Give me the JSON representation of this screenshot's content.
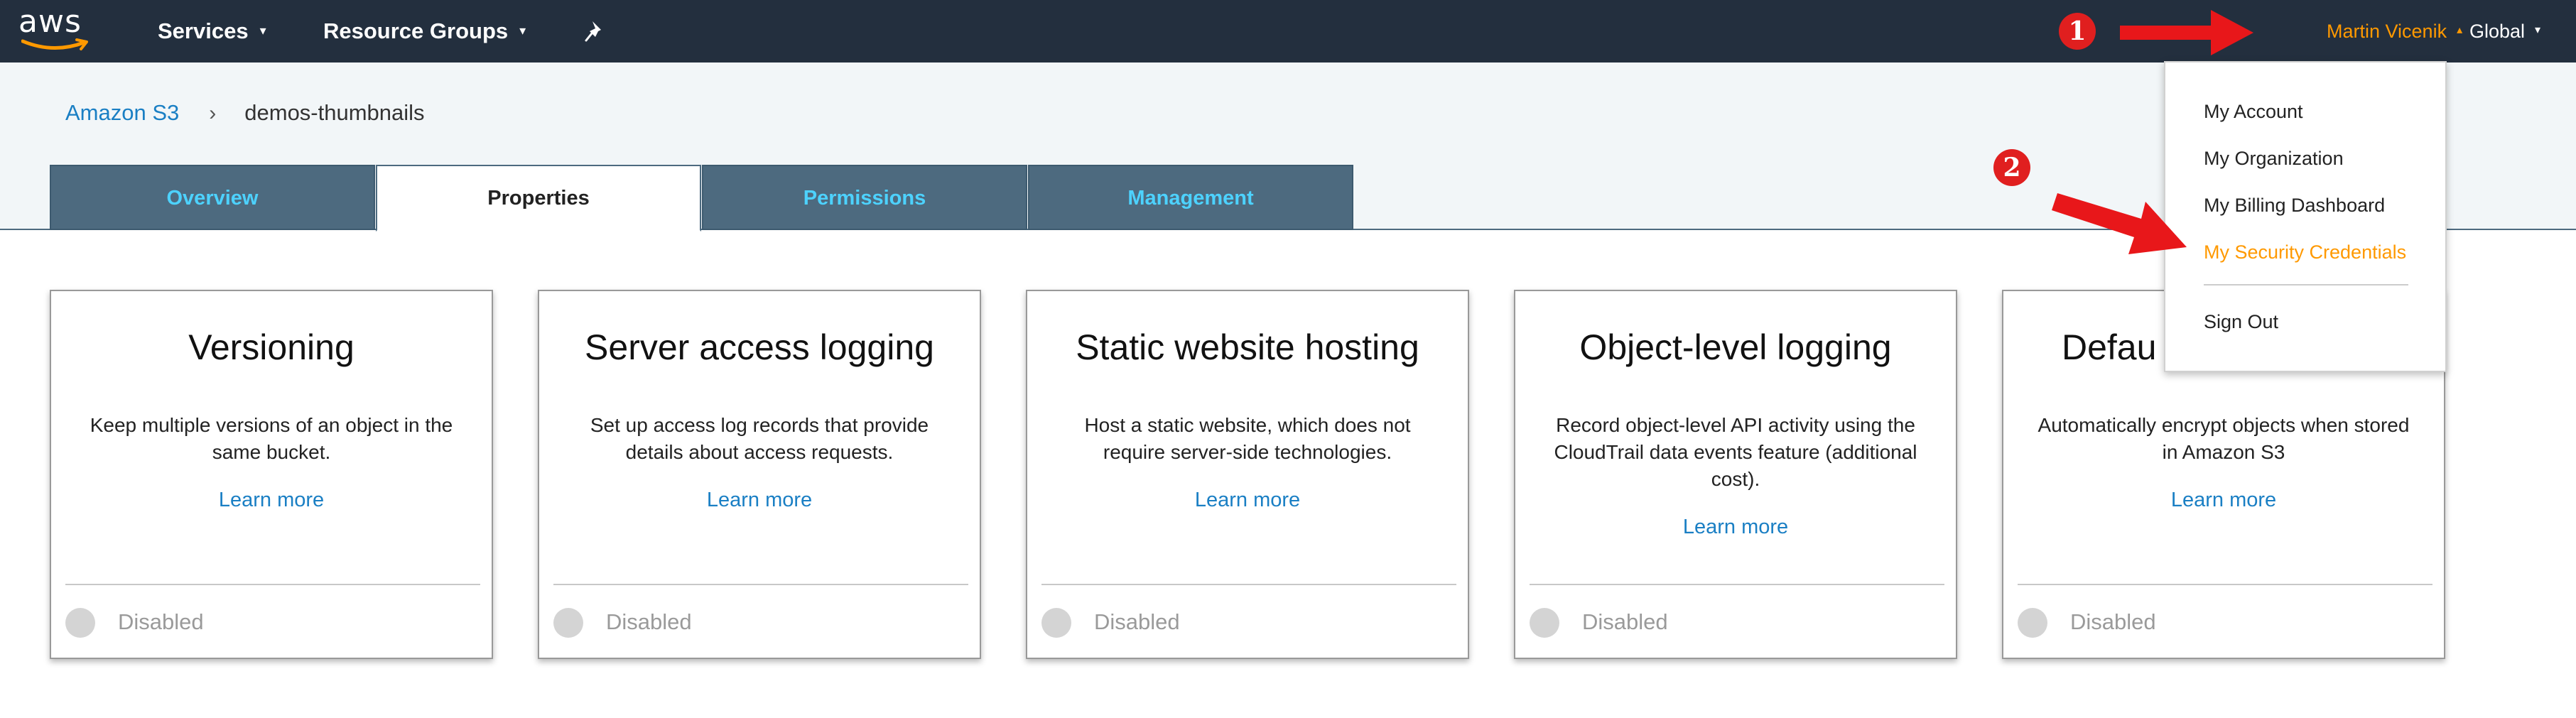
{
  "topnav": {
    "logo_text": "aws",
    "services_label": "Services",
    "resource_groups_label": "Resource Groups",
    "pin_icon": "pin-icon",
    "user_label": "Martin Vicenik",
    "region_label": "Global",
    "caret": "▾",
    "caret_up": "▴"
  },
  "breadcrumb": {
    "root": "Amazon S3",
    "separator": "›",
    "current": "demos-thumbnails"
  },
  "tabs": [
    {
      "label": "Overview",
      "active": false
    },
    {
      "label": "Properties",
      "active": true
    },
    {
      "label": "Permissions",
      "active": false
    },
    {
      "label": "Management",
      "active": false
    }
  ],
  "cards": [
    {
      "title": "Versioning",
      "description": "Keep multiple versions of an object in the same bucket.",
      "link": "Learn more",
      "status": "Disabled"
    },
    {
      "title": "Server access logging",
      "description": "Set up access log records that provide details about access requests.",
      "link": "Learn more",
      "status": "Disabled"
    },
    {
      "title": "Static website hosting",
      "description": "Host a static website, which does not require server-side technologies.",
      "link": "Learn more",
      "status": "Disabled"
    },
    {
      "title": "Object-level logging",
      "description": "Record object-level API activity using the CloudTrail data events feature (additional cost).",
      "link": "Learn more",
      "status": "Disabled"
    },
    {
      "title": "Defau",
      "description": "Automatically encrypt objects when stored in Amazon S3",
      "link": "Learn more",
      "status": "Disabled"
    }
  ],
  "user_menu": {
    "items": [
      "My Account",
      "My Organization",
      "My Billing Dashboard",
      "My Security Credentials"
    ],
    "highlighted_index": 3,
    "sign_out": "Sign Out"
  },
  "annotations": {
    "marker_1": "1",
    "marker_2": "2"
  },
  "colors": {
    "nav_background": "#232f3e",
    "accent_orange": "#ff9900",
    "tab_inactive": "#4d6a7f",
    "tab_inactive_text": "#4dd2ff",
    "link_blue": "#1a7fc4",
    "annotation_red": "#e01f1f"
  }
}
